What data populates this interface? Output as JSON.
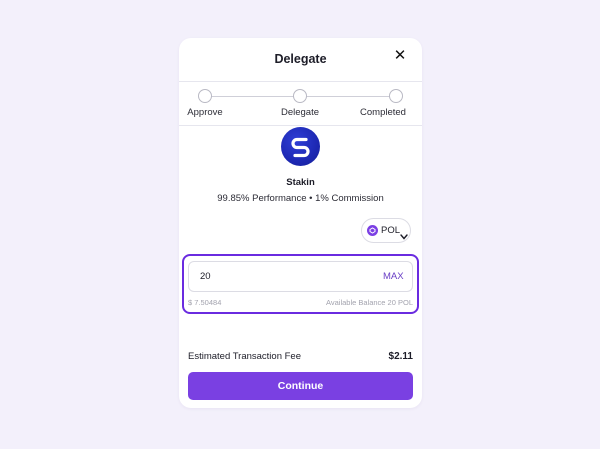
{
  "modal": {
    "title": "Delegate",
    "close_icon": "close-icon"
  },
  "stepper": {
    "steps": [
      {
        "label": "Approve"
      },
      {
        "label": "Delegate"
      },
      {
        "label": "Completed"
      }
    ]
  },
  "validator": {
    "logo_icon": "stakin-logo",
    "name": "Stakin",
    "stats": "99.85% Performance • 1% Commission"
  },
  "token_select": {
    "icon": "polygon-token-icon",
    "label": "POL",
    "chevron": "chevron-down-icon"
  },
  "amount": {
    "value": "20",
    "max_label": "MAX",
    "usd_value": "$ 7.50484",
    "available_balance": "Available Balance 20 POL"
  },
  "fee": {
    "label": "Estimated Transaction Fee",
    "value": "$2.11"
  },
  "continue_label": "Continue",
  "colors": {
    "background": "#f3f0fb",
    "accent": "#7a40e2",
    "focus_outline": "#6a2be0",
    "logo_blue": "#1d28b3"
  }
}
